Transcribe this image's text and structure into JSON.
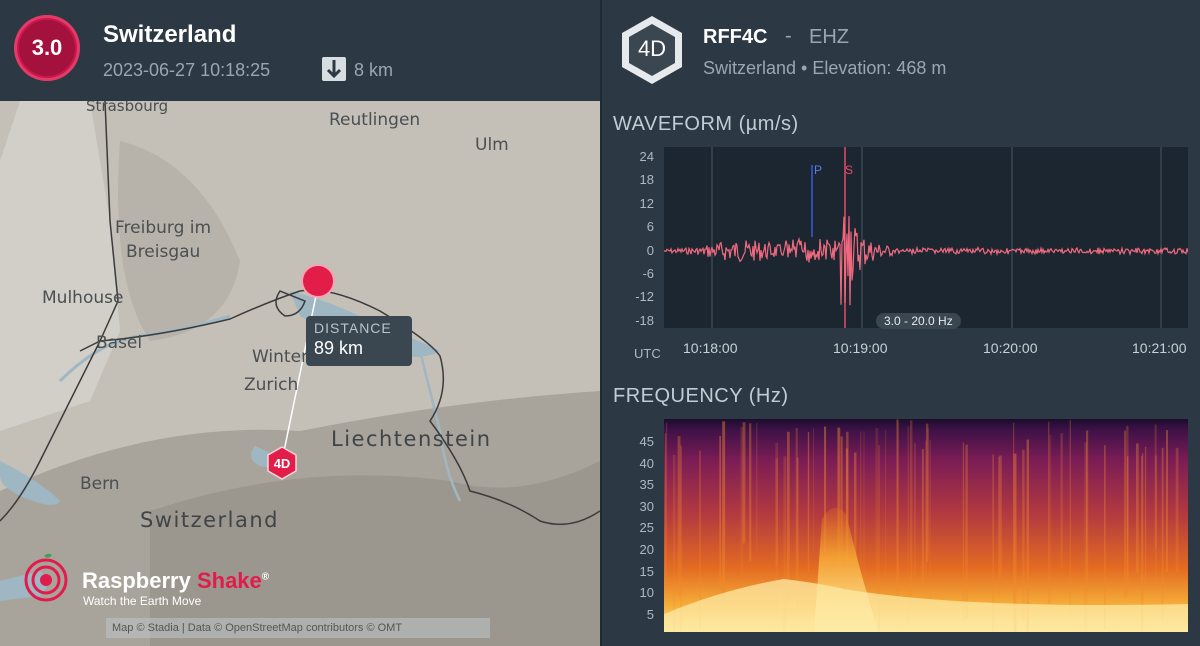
{
  "event": {
    "magnitude": "3.0",
    "region": "Switzerland",
    "datetime": "2023-06-27 10:18:25",
    "depth": "8 km",
    "depth_icon": "arrow-down-icon"
  },
  "map": {
    "labels": {
      "strasbourg": "Strasbourg",
      "reutlingen": "Reutlingen",
      "ulm": "Ulm",
      "freiburg1": "Freiburg im",
      "freiburg2": "Breisgau",
      "mulhouse": "Mulhouse",
      "basel": "Basel",
      "winterthur": "Winter",
      "zurich": "Zurich",
      "liechtenstein": "Liechtenstein",
      "bern": "Bern",
      "switzerland": "Switzerland"
    },
    "distance_title": "DISTANCE",
    "distance_value": "89 km",
    "station_marker": "4D",
    "brand_name_1": "Raspberry ",
    "brand_name_2": "Shake",
    "brand_reg": "®",
    "brand_tagline": "Watch the Earth Move",
    "attribution": "Map © Stadia | Data © OpenStreetMap contributors © OMT"
  },
  "station": {
    "badge": "4D",
    "code": "RFF4C",
    "separator": "-",
    "channel": "EHZ",
    "location": "Switzerland • Elevation: 468 m"
  },
  "waveform": {
    "title": "WAVEFORM (µm/s)",
    "tz": "UTC",
    "filter": "3.0 - 20.0 Hz",
    "phase_p": "P",
    "phase_s": "S",
    "y_ticks": [
      "24",
      "18",
      "12",
      "6",
      "0",
      "-6",
      "-12",
      "-18"
    ],
    "time_ticks": [
      "10:18:00",
      "10:19:00",
      "10:20:00",
      "10:21:00"
    ]
  },
  "frequency": {
    "title": "FREQUENCY (Hz)",
    "y_ticks": [
      "45",
      "40",
      "35",
      "30",
      "25",
      "20",
      "15",
      "10",
      "5"
    ]
  },
  "colors": {
    "background": "#2c3944",
    "accent": "#e11d48",
    "trace": "#f06a7f",
    "p_line": "#3b5bd6",
    "s_line": "#e54a6a"
  }
}
